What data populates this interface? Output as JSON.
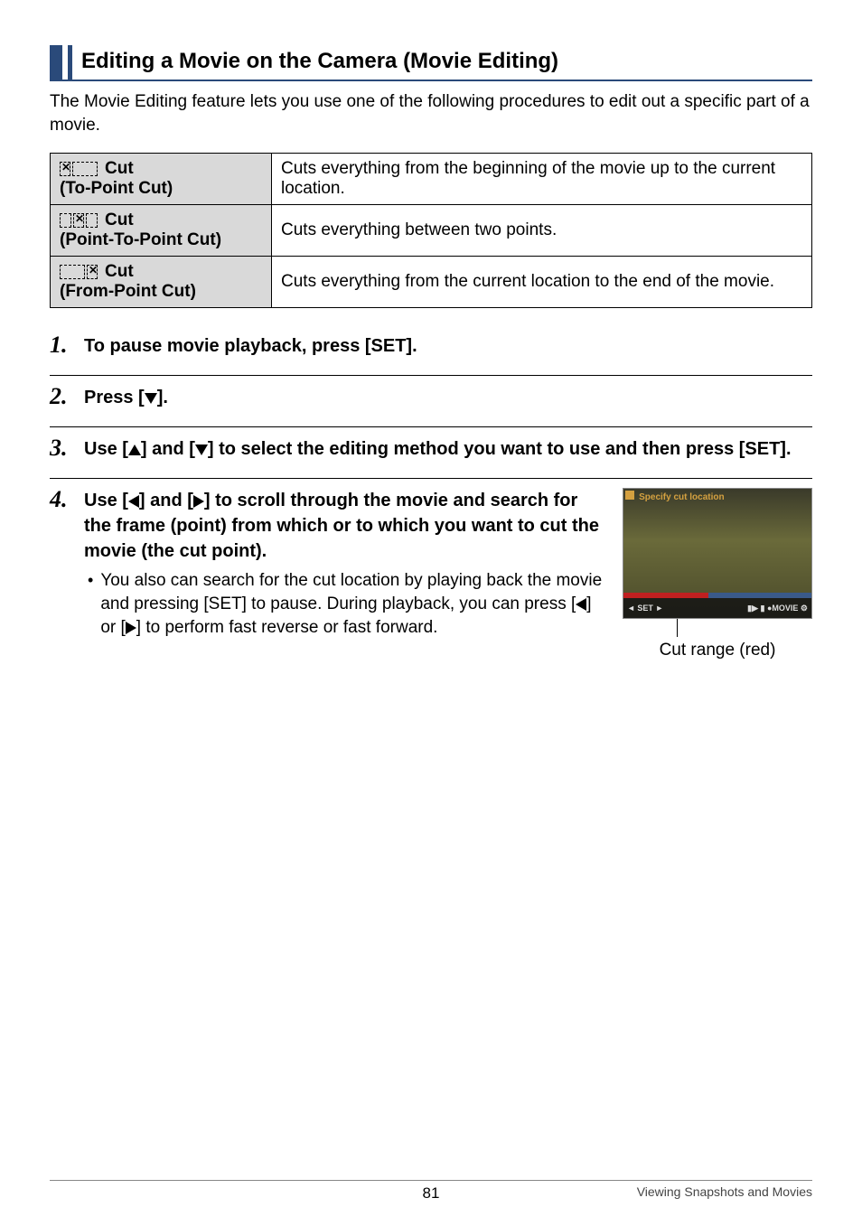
{
  "section_title": "Editing a Movie on the Camera (Movie Editing)",
  "intro": "The Movie Editing feature lets you use one of the following procedures to edit out a specific part of a movie.",
  "table": {
    "rows": [
      {
        "label_cut": "Cut",
        "label_sub": "(To-Point Cut)",
        "desc": "Cuts everything from the beginning of the movie up to the current location."
      },
      {
        "label_cut": "Cut",
        "label_sub": "(Point-To-Point Cut)",
        "desc": "Cuts everything between two points."
      },
      {
        "label_cut": "Cut",
        "label_sub": "(From-Point Cut)",
        "desc": "Cuts everything from the current location to the end of the movie."
      }
    ]
  },
  "steps": {
    "s1": {
      "num": "1.",
      "text": "To pause movie playback, press [SET]."
    },
    "s2": {
      "num": "2.",
      "prefix": "Press [",
      "suffix": "]."
    },
    "s3": {
      "num": "3.",
      "prefix": "Use [",
      "mid1": "] and [",
      "mid2": "] to select the editing method you want to use and then press [SET]."
    },
    "s4": {
      "num": "4.",
      "prefix": "Use [",
      "mid1": "] and [",
      "mid2": "] to scroll through the movie and search for the frame (point) from which or to which you want to cut the movie (the cut point).",
      "bullet_prefix": "You also can search for the cut location by playing back the movie and pressing [SET] to pause. During playback, you can press [",
      "bullet_mid": "] or [",
      "bullet_suffix": "] to perform fast reverse or fast forward."
    }
  },
  "thumb": {
    "banner": "Specify cut location",
    "caption": "Cut range (red)"
  },
  "footer": {
    "page": "81",
    "section": "Viewing Snapshots and Movies"
  }
}
